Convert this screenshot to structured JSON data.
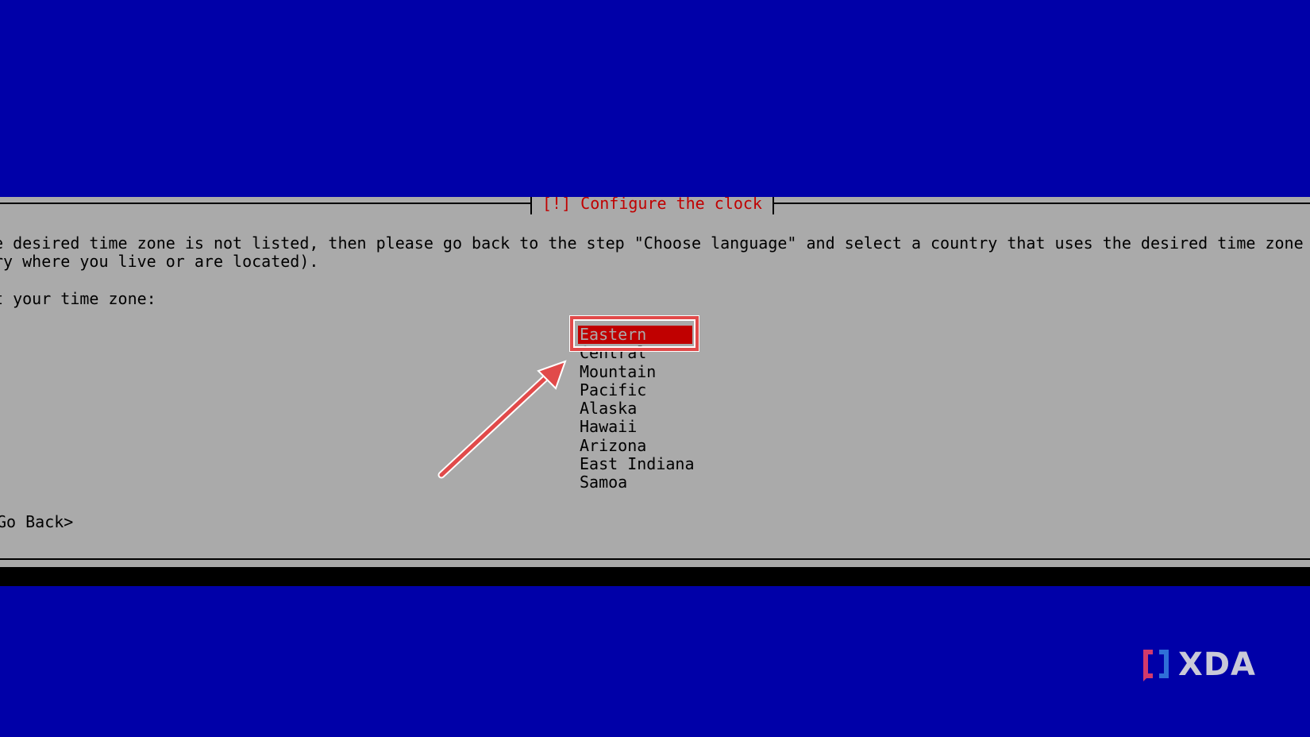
{
  "dialog": {
    "title": "[!] Configure the clock",
    "description_line1": "e desired time zone is not listed, then please go back to the step \"Choose language\" and select a country that uses the desired time zone (the",
    "description_line2": "ry where you live or are located).",
    "prompt": "t your time zone:",
    "timezones": [
      {
        "label": "Eastern",
        "selected": true
      },
      {
        "label": "Central",
        "selected": false
      },
      {
        "label": "Mountain",
        "selected": false
      },
      {
        "label": "Pacific",
        "selected": false
      },
      {
        "label": "Alaska",
        "selected": false
      },
      {
        "label": "Hawaii",
        "selected": false
      },
      {
        "label": "Arizona",
        "selected": false
      },
      {
        "label": "East Indiana",
        "selected": false
      },
      {
        "label": "Samoa",
        "selected": false
      }
    ],
    "go_back": "Go Back>"
  },
  "watermark": {
    "text": "XDA",
    "icon": "xda-logo-icon"
  },
  "colors": {
    "background": "#0000a8",
    "dialog": "#aaaaaa",
    "title": "#c00000",
    "selected": "#c00000",
    "annotation": "#e14a4a"
  }
}
